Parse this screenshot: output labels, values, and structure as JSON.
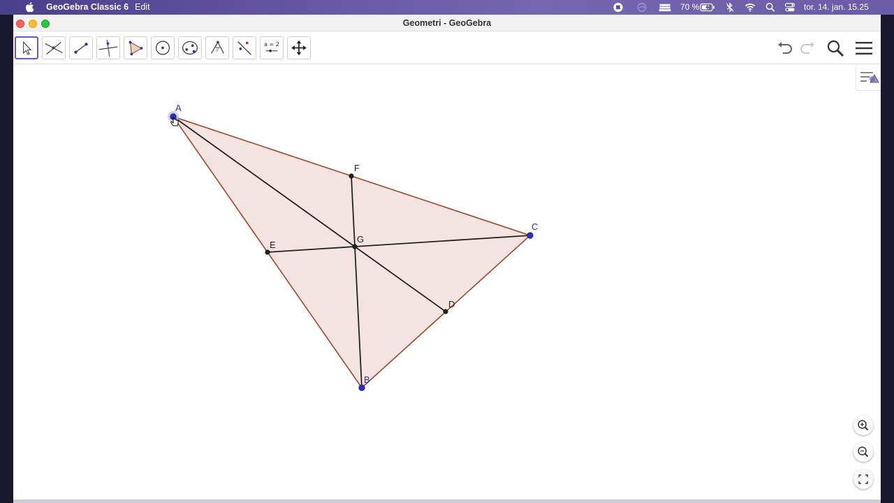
{
  "menubar": {
    "app_name": "GeoGebra Classic 6",
    "menu_edit": "Edit",
    "battery": "70 %",
    "datetime": "tor. 14. jan.  15.25",
    "icons": [
      "apple-icon",
      "screen-record-icon",
      "siri-icon",
      "stacks-icon",
      "battery-icon",
      "bluetooth-icon",
      "wifi-icon",
      "spotlight-icon",
      "control-center-icon"
    ]
  },
  "window": {
    "title": "Geometri - GeoGebra"
  },
  "toolbar": {
    "tools": [
      "move-tool",
      "point-tool",
      "segment-tool",
      "perpendicular-line-tool",
      "polygon-tool",
      "circle-tool",
      "conic-tool",
      "angle-tool",
      "reflect-tool",
      "slider-tool",
      "move-graphics-view-tool"
    ],
    "slider_label": "a = 2",
    "right_buttons": [
      "undo-icon",
      "redo-icon",
      "search-icon",
      "menu-icon"
    ]
  },
  "construction": {
    "points": {
      "A": {
        "label": "A",
        "color": "#2f2fb8",
        "free": true
      },
      "B": {
        "label": "B",
        "color": "#2f2fb8",
        "free": true
      },
      "C": {
        "label": "C",
        "color": "#2f2fb8",
        "free": true
      },
      "D": {
        "label": "D",
        "color": "#222222",
        "free": false
      },
      "E": {
        "label": "E",
        "color": "#222222",
        "free": false
      },
      "F": {
        "label": "F",
        "color": "#222222",
        "free": false
      },
      "G": {
        "label": "G",
        "color": "#222222",
        "free": false
      }
    },
    "polygon_fill": "#f3e4e1",
    "polygon_stroke": "#a0472a",
    "median_color": "#222222"
  },
  "graphics_controls": [
    "style-bar-toggle-icon",
    "zoom-in-icon",
    "zoom-out-icon",
    "fullscreen-icon"
  ]
}
